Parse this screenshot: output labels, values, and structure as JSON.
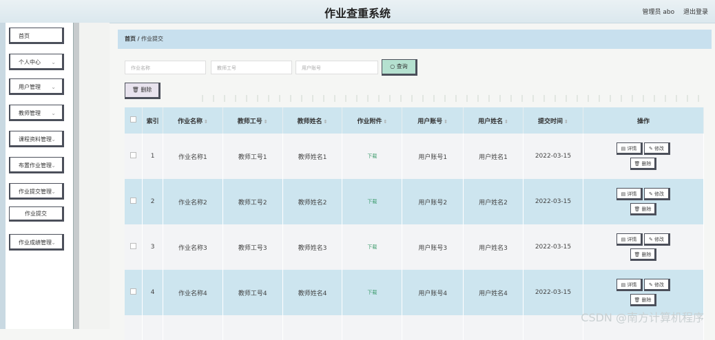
{
  "header": {
    "title": "作业查重系统",
    "user": "管理员 abo",
    "logout": "退出登录"
  },
  "sidebar": {
    "items": [
      {
        "label": "首页"
      },
      {
        "label": "个人中心"
      },
      {
        "label": "用户管理"
      },
      {
        "label": "教师管理"
      },
      {
        "label": "课程资料管理"
      },
      {
        "label": "布置作业管理"
      },
      {
        "label": "作业提交管理"
      },
      {
        "label": "作业成绩管理"
      }
    ],
    "sub_item": "作业提交"
  },
  "breadcrumb": {
    "home": "首页",
    "sep": "/",
    "current": "作业提交"
  },
  "search": {
    "name_placeholder": "作业名称",
    "teacher_id_placeholder": "教师工号",
    "user_account_placeholder": "用户账号",
    "query": "查询"
  },
  "toolbar": {
    "delete": "删除"
  },
  "table": {
    "headers": [
      "索引",
      "作业名称",
      "教师工号",
      "教师姓名",
      "作业附件",
      "用户账号",
      "用户姓名",
      "提交时间",
      "操作"
    ],
    "rows": [
      {
        "index": "1",
        "name": "作业名称1",
        "tid": "教师工号1",
        "tname": "教师姓名1",
        "file": "下载",
        "acct": "用户账号1",
        "uname": "用户姓名1",
        "time": "2022-03-15"
      },
      {
        "index": "2",
        "name": "作业名称2",
        "tid": "教师工号2",
        "tname": "教师姓名2",
        "file": "下载",
        "acct": "用户账号2",
        "uname": "用户姓名2",
        "time": "2022-03-15"
      },
      {
        "index": "3",
        "name": "作业名称3",
        "tid": "教师工号3",
        "tname": "教师姓名3",
        "file": "下载",
        "acct": "用户账号3",
        "uname": "用户姓名3",
        "time": "2022-03-15"
      },
      {
        "index": "4",
        "name": "作业名称4",
        "tid": "教师工号4",
        "tname": "教师姓名4",
        "file": "下载",
        "acct": "用户账号4",
        "uname": "用户姓名4",
        "time": "2022-03-15"
      }
    ],
    "actions": {
      "detail": "详情",
      "edit": "修改",
      "delete": "删除"
    }
  },
  "watermark": "CSDN @南方计算机程序"
}
